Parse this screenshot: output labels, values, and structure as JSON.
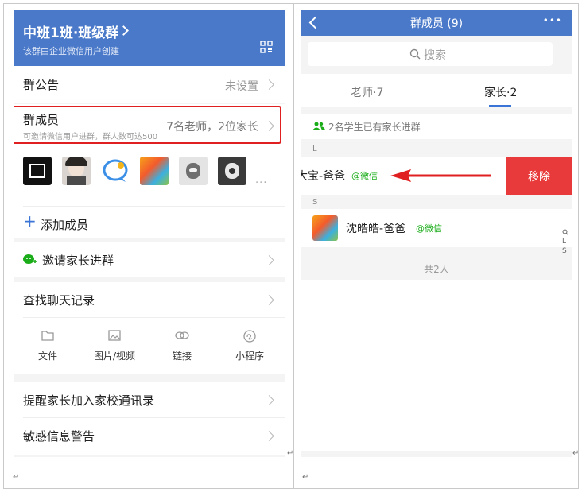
{
  "left": {
    "header": {
      "title": "中班1班·班级群",
      "subtitle": "该群由企业微信用户创建"
    },
    "announcement": {
      "label": "群公告",
      "value": "未设置"
    },
    "members": {
      "label": "群成员",
      "hint": "可邀请微信用户进群，群人数可达500",
      "value": "7名老师，2位家长"
    },
    "add_member": {
      "label": "添加成员",
      "plus": "+"
    },
    "more_dots": "...",
    "invite": {
      "label": "邀请家长进群"
    },
    "search_chat": {
      "label": "查找聊天记录"
    },
    "tools": [
      {
        "label": "文件"
      },
      {
        "label": "图片/视频"
      },
      {
        "label": "链接"
      },
      {
        "label": "小程序"
      }
    ],
    "remind": {
      "label": "提醒家长加入家校通讯录"
    },
    "sensitive": {
      "label": "敏感信息警告"
    }
  },
  "right": {
    "header": {
      "back": "<",
      "title": "群成员 (9)",
      "more": "•••"
    },
    "search": {
      "placeholder": "搜索"
    },
    "tabs": [
      {
        "label": "老师·7"
      },
      {
        "label": "家长·2",
        "active": true
      }
    ],
    "notice": "2名学生已有家长进群",
    "sections": [
      {
        "letter": "L",
        "name": "大宝-爸爸",
        "source": "@微信",
        "action": "移除"
      },
      {
        "letter": "S",
        "name": "沈皓皓-爸爸",
        "source": "@微信"
      }
    ],
    "index": [
      "L",
      "S"
    ],
    "total": "共2人"
  },
  "colors": {
    "header_blue": "#4a79c9",
    "highlight_red": "#e02020",
    "delete_red": "#e83a3a",
    "wechat_green": "#1aad19",
    "tab_blue": "#3a74d6"
  }
}
